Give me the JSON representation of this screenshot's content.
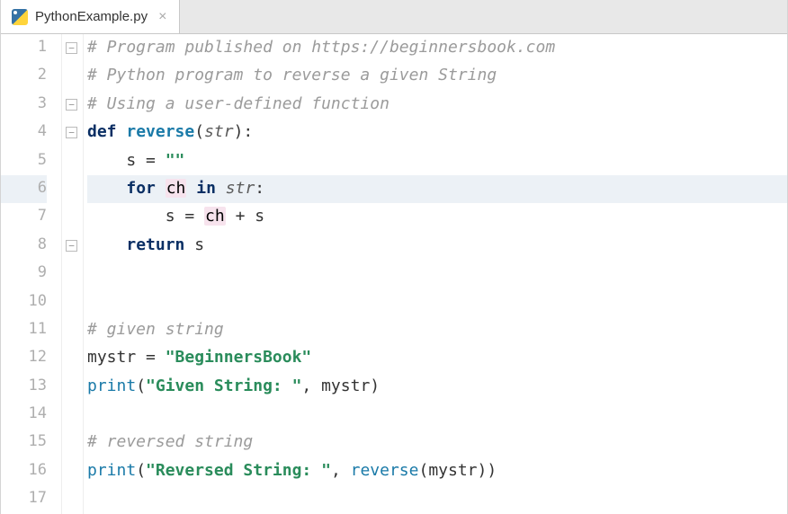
{
  "tab": {
    "filename": "PythonExample.py",
    "close_glyph": "×"
  },
  "gutter": {
    "start": 1,
    "end": 17
  },
  "current_line": 6,
  "fold_markers": [
    {
      "line": 1,
      "glyph": "−"
    },
    {
      "line": 3,
      "glyph": "−"
    },
    {
      "line": 4,
      "glyph": "−"
    },
    {
      "line": 8,
      "glyph": "−"
    }
  ],
  "code": {
    "lines": [
      {
        "n": 1,
        "tokens": [
          {
            "t": "# Program published on https://beginnersbook.com",
            "c": "cmt"
          }
        ]
      },
      {
        "n": 2,
        "tokens": [
          {
            "t": "# Python program to reverse a given String",
            "c": "cmt"
          }
        ]
      },
      {
        "n": 3,
        "tokens": [
          {
            "t": "# Using a user-defined function",
            "c": "cmt"
          }
        ]
      },
      {
        "n": 4,
        "tokens": [
          {
            "t": "def ",
            "c": "kw"
          },
          {
            "t": "reverse",
            "c": "fn"
          },
          {
            "t": "(",
            "c": "id"
          },
          {
            "t": "str",
            "c": "param"
          },
          {
            "t": "):",
            "c": "id"
          }
        ]
      },
      {
        "n": 5,
        "tokens": [
          {
            "t": "    s ",
            "c": "id"
          },
          {
            "t": "= ",
            "c": "id"
          },
          {
            "t": "\"\"",
            "c": "str"
          }
        ]
      },
      {
        "n": 6,
        "tokens": [
          {
            "t": "    ",
            "c": "id"
          },
          {
            "t": "for ",
            "c": "kw"
          },
          {
            "t": "ch",
            "c": "ch-hl"
          },
          {
            "t": " ",
            "c": "id"
          },
          {
            "t": "in ",
            "c": "kw"
          },
          {
            "t": "str",
            "c": "param"
          },
          {
            "t": ":",
            "c": "id"
          }
        ]
      },
      {
        "n": 7,
        "tokens": [
          {
            "t": "        s = ",
            "c": "id"
          },
          {
            "t": "ch",
            "c": "ch-hl"
          },
          {
            "t": " + s",
            "c": "id"
          }
        ]
      },
      {
        "n": 8,
        "tokens": [
          {
            "t": "    ",
            "c": "id"
          },
          {
            "t": "return ",
            "c": "kw"
          },
          {
            "t": "s",
            "c": "id"
          }
        ]
      },
      {
        "n": 9,
        "tokens": []
      },
      {
        "n": 10,
        "tokens": []
      },
      {
        "n": 11,
        "tokens": [
          {
            "t": "# given string",
            "c": "cmt"
          }
        ]
      },
      {
        "n": 12,
        "tokens": [
          {
            "t": "mystr ",
            "c": "id"
          },
          {
            "t": "= ",
            "c": "id"
          },
          {
            "t": "\"BeginnersBook\"",
            "c": "str"
          }
        ]
      },
      {
        "n": 13,
        "tokens": [
          {
            "t": "print",
            "c": "built"
          },
          {
            "t": "(",
            "c": "id"
          },
          {
            "t": "\"Given String: \"",
            "c": "str"
          },
          {
            "t": ", mystr)",
            "c": "id"
          }
        ]
      },
      {
        "n": 14,
        "tokens": []
      },
      {
        "n": 15,
        "tokens": [
          {
            "t": "# reversed string",
            "c": "cmt"
          }
        ]
      },
      {
        "n": 16,
        "tokens": [
          {
            "t": "print",
            "c": "built"
          },
          {
            "t": "(",
            "c": "id"
          },
          {
            "t": "\"Reversed String: \"",
            "c": "str"
          },
          {
            "t": ", ",
            "c": "id"
          },
          {
            "t": "reverse",
            "c": "fnc"
          },
          {
            "t": "(mystr))",
            "c": "id"
          }
        ]
      },
      {
        "n": 17,
        "tokens": []
      }
    ]
  }
}
